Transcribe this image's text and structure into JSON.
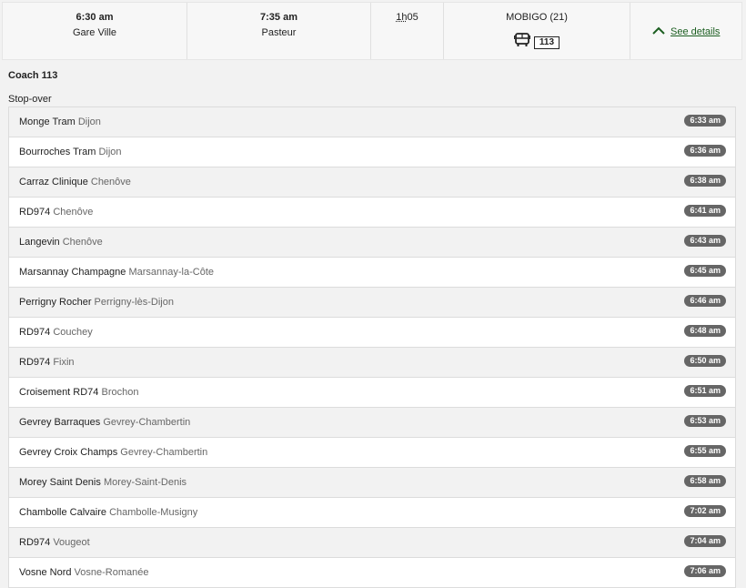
{
  "summary": {
    "departure": {
      "time": "6:30 am",
      "station": "Gare Ville"
    },
    "arrival": {
      "time": "7:35 am",
      "station": "Pasteur"
    },
    "duration": {
      "hours": "1h",
      "minutes": "05"
    },
    "operator": {
      "name": "MOBIGO (21)",
      "line": "113",
      "mode_icon": "bus-icon"
    },
    "details_link": "See details",
    "details_icon": "chevron-up-icon"
  },
  "coach_label": "Coach 113",
  "stopover_label": "Stop-over",
  "stops": [
    {
      "name": "Monge Tram",
      "town": "Dijon",
      "time": "6:33 am"
    },
    {
      "name": "Bourroches Tram",
      "town": "Dijon",
      "time": "6:36 am"
    },
    {
      "name": "Carraz Clinique",
      "town": "Chenôve",
      "time": "6:38 am"
    },
    {
      "name": "RD974",
      "town": "Chenôve",
      "time": "6:41 am"
    },
    {
      "name": "Langevin",
      "town": "Chenôve",
      "time": "6:43 am"
    },
    {
      "name": "Marsannay Champagne",
      "town": "Marsannay-la-Côte",
      "time": "6:45 am"
    },
    {
      "name": "Perrigny Rocher",
      "town": "Perrigny-lès-Dijon",
      "time": "6:46 am"
    },
    {
      "name": "RD974",
      "town": "Couchey",
      "time": "6:48 am"
    },
    {
      "name": "RD974",
      "town": "Fixin",
      "time": "6:50 am"
    },
    {
      "name": "Croisement RD74",
      "town": "Brochon",
      "time": "6:51 am"
    },
    {
      "name": "Gevrey Barraques",
      "town": "Gevrey-Chambertin",
      "time": "6:53 am"
    },
    {
      "name": "Gevrey Croix Champs",
      "town": "Gevrey-Chambertin",
      "time": "6:55 am"
    },
    {
      "name": "Morey Saint Denis",
      "town": "Morey-Saint-Denis",
      "time": "6:58 am"
    },
    {
      "name": "Chambolle Calvaire",
      "town": "Chambolle-Musigny",
      "time": "7:02 am"
    },
    {
      "name": "RD974",
      "town": "Vougeot",
      "time": "7:04 am"
    },
    {
      "name": "Vosne Nord",
      "town": "Vosne-Romanée",
      "time": "7:06 am"
    }
  ]
}
